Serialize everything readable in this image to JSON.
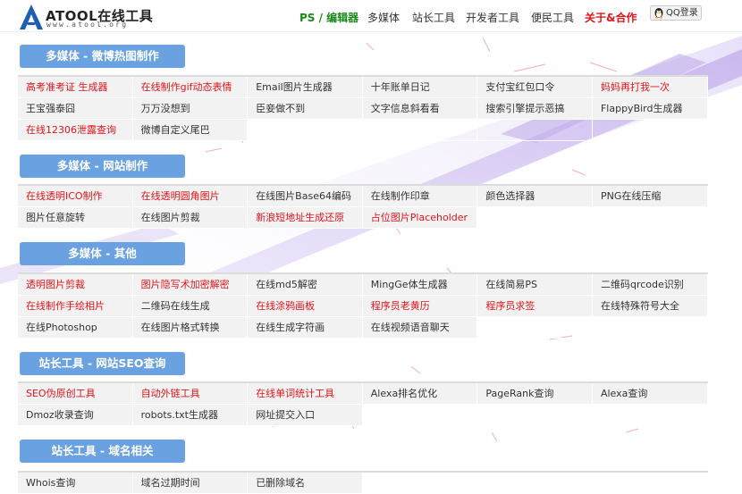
{
  "header": {
    "logo_title": "ATOOL在线工具",
    "logo_sub": "www.atool.org",
    "nav": [
      {
        "label": "PS / 编辑器",
        "style": "green"
      },
      {
        "label": "多媒体",
        "style": "normal"
      },
      {
        "label": "站长工具",
        "style": "normal"
      },
      {
        "label": "开发者工具",
        "style": "normal"
      },
      {
        "label": "便民工具",
        "style": "normal"
      },
      {
        "label": "关于&合作",
        "style": "red"
      }
    ],
    "qq_login": "QQ登录"
  },
  "colors": {
    "accent_green": "#1a8a1a",
    "accent_red": "#e0141b",
    "section_blue": "#6aa1e0",
    "decor_purple": "#c9b7ec"
  },
  "sections": [
    {
      "title": "多媒体 - 微博热图制作",
      "rows": [
        [
          {
            "label": "高考准考证 生成器",
            "red": true
          },
          {
            "label": "在线制作gif动态表情",
            "red": true
          },
          {
            "label": "Email图片生成器",
            "red": false
          },
          {
            "label": "十年账单日记",
            "red": false
          },
          {
            "label": "支付宝红包口令",
            "red": false
          },
          {
            "label": "妈妈再打我一次",
            "red": true
          }
        ],
        [
          {
            "label": "王宝强泰囧",
            "red": false
          },
          {
            "label": "万万没想到",
            "red": false
          },
          {
            "label": "臣妾做不到",
            "red": false
          },
          {
            "label": "文字信息斜看看",
            "red": false
          },
          {
            "label": "搜索引擎提示恶搞",
            "red": false
          },
          {
            "label": "FlappyBird生成器",
            "red": false
          }
        ],
        [
          {
            "label": "在线12306泄露查询",
            "red": true
          },
          {
            "label": "微博自定义尾巴",
            "red": false
          }
        ]
      ]
    },
    {
      "title": "多媒体 - 网站制作",
      "rows": [
        [
          {
            "label": "在线透明ICO制作",
            "red": true
          },
          {
            "label": "在线透明圆角图片",
            "red": true
          },
          {
            "label": "在线图片Base64编码",
            "red": false
          },
          {
            "label": "在线制作印章",
            "red": false
          },
          {
            "label": "颜色选择器",
            "red": false
          },
          {
            "label": "PNG在线压缩",
            "red": false
          }
        ],
        [
          {
            "label": "图片任意旋转",
            "red": false
          },
          {
            "label": "在线图片剪裁",
            "red": false
          },
          {
            "label": "新浪短地址生成还原",
            "red": true
          },
          {
            "label": "占位图片Placeholder",
            "red": true
          }
        ]
      ]
    },
    {
      "title": "多媒体 - 其他",
      "rows": [
        [
          {
            "label": "透明图片剪裁",
            "red": true
          },
          {
            "label": "图片隐写术加密解密",
            "red": true
          },
          {
            "label": "在线md5解密",
            "red": false
          },
          {
            "label": "MingGe体生成器",
            "red": false
          },
          {
            "label": "在线简易PS",
            "red": false
          },
          {
            "label": "二维码qrcode识别",
            "red": false
          }
        ],
        [
          {
            "label": "在线制作手绘相片",
            "red": true
          },
          {
            "label": "二维码在线生成",
            "red": false
          },
          {
            "label": "在线涂鸦画板",
            "red": true
          },
          {
            "label": "程序员老黄历",
            "red": true
          },
          {
            "label": "程序员求签",
            "red": true
          },
          {
            "label": "在线特殊符号大全",
            "red": false
          }
        ],
        [
          {
            "label": "在线Photoshop",
            "red": false
          },
          {
            "label": "在线图片格式转换",
            "red": false
          },
          {
            "label": "在线生成字符画",
            "red": false
          },
          {
            "label": "在线视频语音聊天",
            "red": false
          }
        ]
      ]
    },
    {
      "title": "站长工具 - 网站SEO查询",
      "rows": [
        [
          {
            "label": "SEO伪原创工具",
            "red": true
          },
          {
            "label": "自动外链工具",
            "red": true
          },
          {
            "label": "在线单词统计工具",
            "red": true
          },
          {
            "label": "Alexa排名优化",
            "red": false
          },
          {
            "label": "PageRank查询",
            "red": false
          },
          {
            "label": "Alexa查询",
            "red": false
          }
        ],
        [
          {
            "label": "Dmoz收录查询",
            "red": false
          },
          {
            "label": "robots.txt生成器",
            "red": false
          },
          {
            "label": "网址提交入口",
            "red": false
          }
        ]
      ]
    },
    {
      "title": "站长工具 - 域名相关",
      "rows": [
        [
          {
            "label": "Whois查询",
            "red": false
          },
          {
            "label": "域名过期时间",
            "red": false
          },
          {
            "label": "已删除域名",
            "red": false
          }
        ]
      ]
    }
  ]
}
